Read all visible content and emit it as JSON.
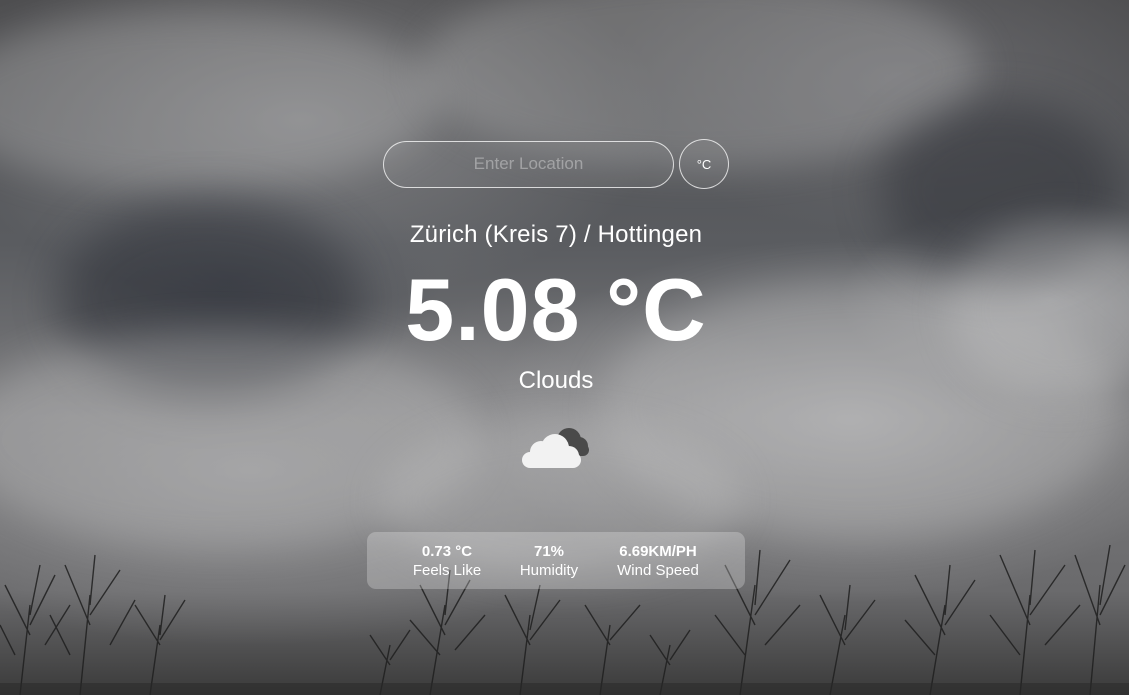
{
  "search": {
    "placeholder": "Enter Location",
    "value": ""
  },
  "unit_toggle": {
    "label": "°C"
  },
  "weather": {
    "location": "Zürich (Kreis 7) / Hottingen",
    "temperature": "5.08 °C",
    "condition": "Clouds",
    "icon": "cloudy-icon"
  },
  "stats": {
    "feels_like": {
      "value": "0.73 °C",
      "label": "Feels Like"
    },
    "humidity": {
      "value": "71%",
      "label": "Humidity"
    },
    "wind_speed": {
      "value": "6.69KM/PH",
      "label": "Wind Speed"
    }
  },
  "colors": {
    "text": "#ffffff",
    "panel": "rgba(255,255,255,0.25)",
    "background": "#5a5a5c"
  }
}
